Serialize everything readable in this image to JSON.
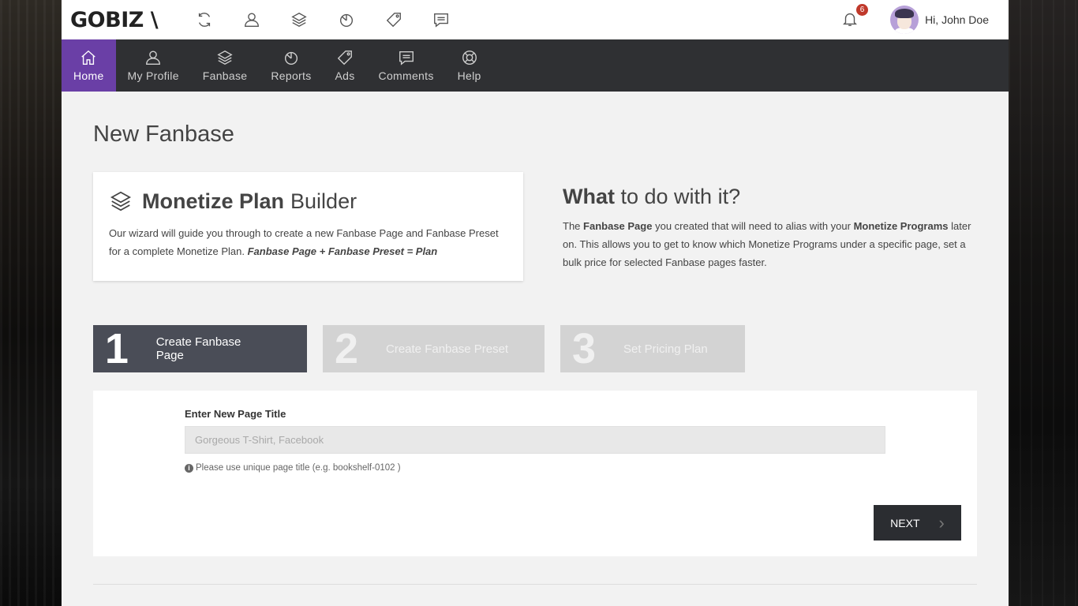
{
  "brand": {
    "logo": "GOBIZ \\"
  },
  "topbar": {
    "icons": [
      "refresh-icon",
      "user-icon",
      "layers-icon",
      "pie-chart-icon",
      "tag-icon",
      "comments-icon"
    ],
    "notification_count": "6",
    "greeting": "Hi, John Doe"
  },
  "nav": {
    "items": [
      {
        "label": "Home",
        "icon": "home-icon"
      },
      {
        "label": "My Profile",
        "icon": "user-icon"
      },
      {
        "label": "Fanbase",
        "icon": "layers-icon"
      },
      {
        "label": "Reports",
        "icon": "pie-chart-icon"
      },
      {
        "label": "Ads",
        "icon": "tag-icon"
      },
      {
        "label": "Comments",
        "icon": "comments-icon"
      },
      {
        "label": "Help",
        "icon": "lifebuoy-icon"
      }
    ],
    "active": "Home"
  },
  "page": {
    "title": "New Fanbase"
  },
  "builder_card": {
    "title_bold": "Monetize Plan",
    "title_rest": "Builder",
    "text": "Our wizard will guide you through to create a new Fanbase Page and Fanbase Preset for a complete Monetize Plan.",
    "formula": "Fanbase Page + Fanbase Preset = Plan"
  },
  "what_box": {
    "title_bold": "What",
    "title_rest": "to do with it?",
    "p1": "The",
    "b1": "Fanbase Page",
    "p2": "you created that will need to alias with your",
    "b2": "Monetize Programs",
    "p3": "later on. This allows you to get to know which Monetize Programs under a specific page, set a bulk price for selected Fanbase pages faster."
  },
  "steps": [
    {
      "num": "1",
      "label": "Create Fanbase Page"
    },
    {
      "num": "2",
      "label": "Create Fanbase Preset"
    },
    {
      "num": "3",
      "label": "Set Pricing Plan"
    }
  ],
  "form": {
    "label": "Enter New Page Title",
    "placeholder": "Gorgeous T-Shirt, Facebook",
    "value": "",
    "hint": "Please use unique page title (e.g. bookshelf-0102 )",
    "next_label": "NEXT"
  },
  "colors": {
    "accent": "#6a3fa6",
    "nav_bg": "#2f3033",
    "step_active": "#4a4d57"
  }
}
